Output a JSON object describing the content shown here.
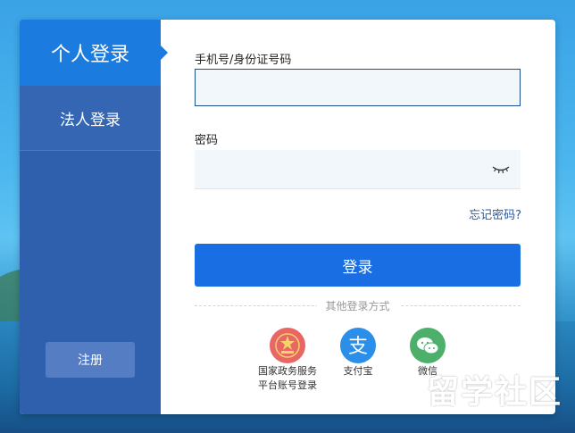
{
  "sidebar": {
    "tab_personal": "个人登录",
    "tab_legal": "法人登录",
    "register": "注册"
  },
  "form": {
    "phone_label": "手机号/身份证号码",
    "phone_value": "",
    "password_label": "密码",
    "password_value": "",
    "forgot": "忘记密码?",
    "login": "登录",
    "other_methods": "其他登录方式",
    "eye_icon": "eye-closed-icon"
  },
  "other_login": [
    {
      "icon": "government-emblem-icon",
      "label": "国家政务服务\n平台账号登录"
    },
    {
      "icon": "alipay-icon",
      "label": "支付宝"
    },
    {
      "icon": "wechat-icon",
      "label": "微信"
    }
  ],
  "watermark": {
    "text": "留学社区",
    "url": "bbs.liuxue86.com"
  },
  "colors": {
    "sidebar_bg": "#2f60ad",
    "active_tab": "#1b7bdf",
    "login_button": "#1a6ee3",
    "gov_icon": "#e86664",
    "alipay_icon": "#2b8ee8",
    "wechat_icon": "#4db06a"
  }
}
